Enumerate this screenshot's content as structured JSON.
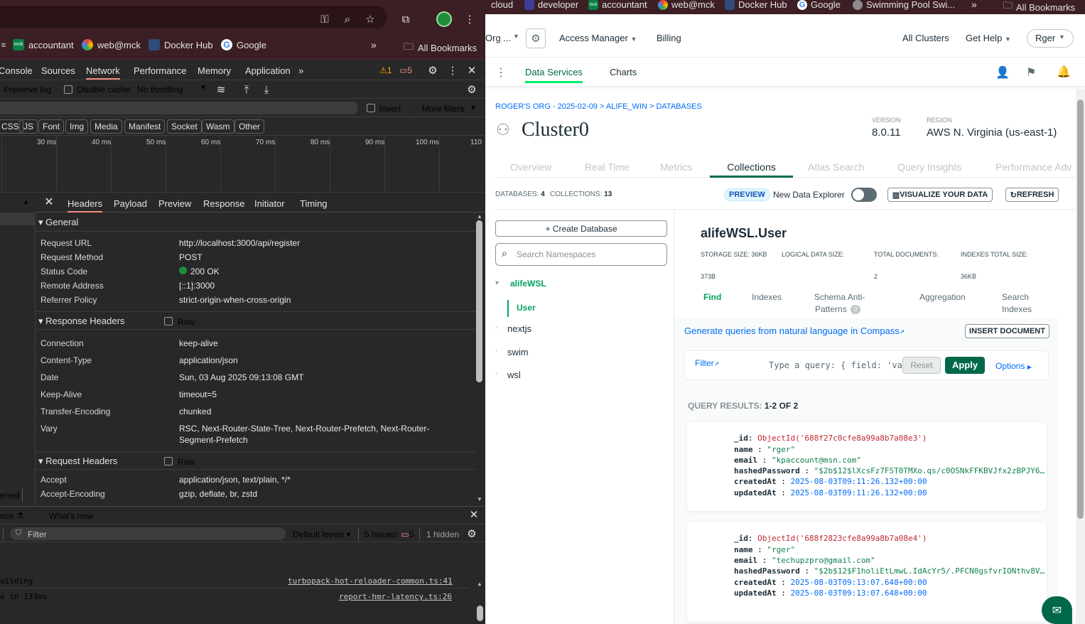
{
  "devtools": {
    "bookmarks": [
      {
        "label": "accountant"
      },
      {
        "label": "web@mck"
      },
      {
        "label": "Docker Hub"
      },
      {
        "label": "Google"
      }
    ],
    "all_bookmarks": "All Bookmarks",
    "tabs": [
      "Console",
      "Sources",
      "Network",
      "Performance",
      "Memory",
      "Application"
    ],
    "warnings": "1",
    "issues": "5",
    "toolbar": {
      "preserve_log": "Preserve log",
      "disable_cache": "Disable cache",
      "throttling": "No throttling"
    },
    "filter": {
      "invert": "Invert",
      "more_filters": "More filters"
    },
    "type_chips": [
      "CSS",
      "JS",
      "Font",
      "Img",
      "Media",
      "Manifest",
      "Socket",
      "Wasm",
      "Other"
    ],
    "timeline_ticks": [
      "30 ms",
      "40 ms",
      "50 ms",
      "60 ms",
      "70 ms",
      "80 ms",
      "90 ms",
      "100 ms",
      "110"
    ],
    "request_tabs": [
      "Headers",
      "Payload",
      "Preview",
      "Response",
      "Initiator",
      "Timing"
    ],
    "general": {
      "title": "General",
      "rows": [
        {
          "k": "Request URL",
          "v": "http://localhost:3000/api/register"
        },
        {
          "k": "Request Method",
          "v": "POST"
        },
        {
          "k": "Status Code",
          "v": "200 OK"
        },
        {
          "k": "Remote Address",
          "v": "[::1]:3000"
        },
        {
          "k": "Referrer Policy",
          "v": "strict-origin-when-cross-origin"
        }
      ]
    },
    "response_headers": {
      "title": "Response Headers",
      "raw": "Raw",
      "rows": [
        {
          "k": "Connection",
          "v": "keep-alive"
        },
        {
          "k": "Content-Type",
          "v": "application/json"
        },
        {
          "k": "Date",
          "v": "Sun, 03 Aug 2025 09:13:08 GMT"
        },
        {
          "k": "Keep-Alive",
          "v": "timeout=5"
        },
        {
          "k": "Transfer-Encoding",
          "v": "chunked"
        },
        {
          "k": "Vary",
          "v": "RSC, Next-Router-State-Tree, Next-Router-Prefetch, Next-Router-",
          "v2": "Segment-Prefetch"
        }
      ]
    },
    "request_headers": {
      "title": "Request Headers",
      "raw": "Raw",
      "rows": [
        {
          "k": "Accept",
          "v": "application/json, text/plain, */*"
        },
        {
          "k": "Accept-Encoding",
          "v": "gzip, deflate, br, zstd"
        }
      ]
    },
    "left_partial": "erred",
    "drawer": {
      "tab1": "nce",
      "tab2": "What's new",
      "filter_placeholder": "Filter",
      "levels": "Default levels",
      "issues_label": "5 Issues:",
      "issues_count": "5",
      "hidden": "1 hidden",
      "log1_text": "uilding",
      "log1_link": "turbopack-hot-reloader-common.ts:41",
      "log2_text": "e in 133ms",
      "log2_link": "report-hmr-latency.ts:26"
    }
  },
  "atlas": {
    "bookmarks": [
      "cloud",
      "developer",
      "accountant",
      "web@mck",
      "Docker Hub",
      "Google",
      "Swimming Pool Swi...",
      "All Bookmarks"
    ],
    "nav": {
      "org": "Org ...",
      "access_manager": "Access Manager",
      "billing": "Billing",
      "all_clusters": "All Clusters",
      "get_help": "Get Help",
      "user": "Rger"
    },
    "subnav": {
      "data_services": "Data Services",
      "charts": "Charts"
    },
    "breadcrumb": "ROGER'S ORG - 2025-02-09 > ALIFE_WIN > DATABASES",
    "cluster_name": "Cluster0",
    "version_label": "VERSION",
    "version": "8.0.11",
    "region_label": "REGION",
    "region": "AWS N. Virginia (us-east-1)",
    "tabs": [
      "Overview",
      "Real Time",
      "Metrics",
      "Collections",
      "Atlas Search",
      "Query Insights",
      "Performance Adv"
    ],
    "databases_label": "DATABASES:",
    "databases_count": "4",
    "collections_label": "COLLECTIONS:",
    "collections_count": "13",
    "preview": "PREVIEW",
    "new_explorer": "New Data Explorer",
    "visualize": "VISUALIZE YOUR DATA",
    "refresh": "REFRESH",
    "create_db": "+ Create Database",
    "search_placeholder": "Search Namespaces",
    "dbs": [
      {
        "name": "alifeWSL",
        "children": [
          "User"
        ]
      },
      {
        "name": "nextjs"
      },
      {
        "name": "swim"
      },
      {
        "name": "wsl"
      }
    ],
    "collection_title": "alifeWSL.User",
    "stats": {
      "storage_label": "STORAGE SIZE: 36KB",
      "logical_label": "LOGICAL DATA SIZE:",
      "total_docs_label": "TOTAL DOCUMENTS:",
      "indexes_label": "INDEXES TOTAL SIZE:",
      "logical": "373B",
      "total_docs": "2",
      "indexes": "36KB"
    },
    "coll_tabs": {
      "find": "Find",
      "indexes": "Indexes",
      "schema1": "Schema Anti-",
      "schema2": "Patterns",
      "schema_count": "0",
      "aggregation": "Aggregation",
      "search1": "Search",
      "search2": "Indexes"
    },
    "compass_link": "Generate queries from natural language in Compass",
    "insert_doc": "INSERT DOCUMENT",
    "filter_label": "Filter",
    "query_placeholder": "Type a query: { field: 'va",
    "reset": "Reset",
    "apply": "Apply",
    "options": "Options",
    "results_label": "QUERY RESULTS:",
    "results_range": "1-2 OF 2",
    "documents": [
      {
        "id": "ObjectId('688f27c0cfe8a99a8b7a08e3')",
        "name": "\"rger\"",
        "email": "\"kpaccount@msn.com\"",
        "hashedPassword": "\"$2b$12$lXcsFz7FST0TMXo.qs/c0OSNkFFKBVJfx2zBPJY6…",
        "createdAt": "2025-08-03T09:11:26.132+00:00",
        "updatedAt": "2025-08-03T09:11:26.132+00:00"
      },
      {
        "id": "ObjectId('688f2823cfe8a99a8b7a08e4')",
        "name": "\"rger\"",
        "email": "\"techupzpro@gmail.com\"",
        "hashedPassword": "\"$2b$12$F1holiEtLmwL.IdAcYr5/.PFCN0gsfvrIONthv8V…",
        "createdAt": "2025-08-03T09:13:07.648+00:00",
        "updatedAt": "2025-08-03T09:13:07.648+00:00"
      }
    ],
    "doc_keys": {
      "id": "_id",
      "name": "name",
      "email": "email",
      "hashedPassword": "hashedPassword",
      "createdAt": "createdAt",
      "updatedAt": "updatedAt"
    }
  }
}
